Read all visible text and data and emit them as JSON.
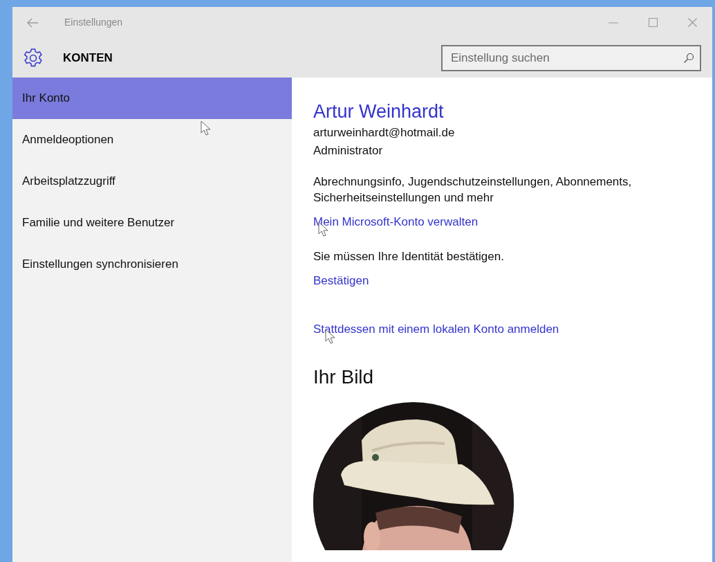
{
  "window": {
    "title": "Einstellungen"
  },
  "header": {
    "title": "KONTEN",
    "search": {
      "placeholder": "Einstellung suchen"
    }
  },
  "sidebar": {
    "items": [
      {
        "label": "Ihr Konto",
        "selected": true
      },
      {
        "label": "Anmeldeoptionen",
        "selected": false
      },
      {
        "label": "Arbeitsplatzzugriff",
        "selected": false
      },
      {
        "label": "Familie und weitere Benutzer",
        "selected": false
      },
      {
        "label": "Einstellungen synchronisieren",
        "selected": false
      }
    ]
  },
  "account": {
    "name": "Artur Weinhardt",
    "email": "arturweinhardt@hotmail.de",
    "role": "Administrator",
    "description": "Abrechnungsinfo, Jugendschutzeinstellungen, Abonnements, Sicherheitseinstellungen und mehr",
    "manage_link": "Mein Microsoft-Konto verwalten",
    "verify_notice": "Sie müssen Ihre Identität bestätigen.",
    "verify_link": "Bestätigen",
    "local_account_link": "Stattdessen mit einem lokalen Konto anmelden"
  },
  "picture_section": {
    "heading": "Ihr Bild"
  }
}
